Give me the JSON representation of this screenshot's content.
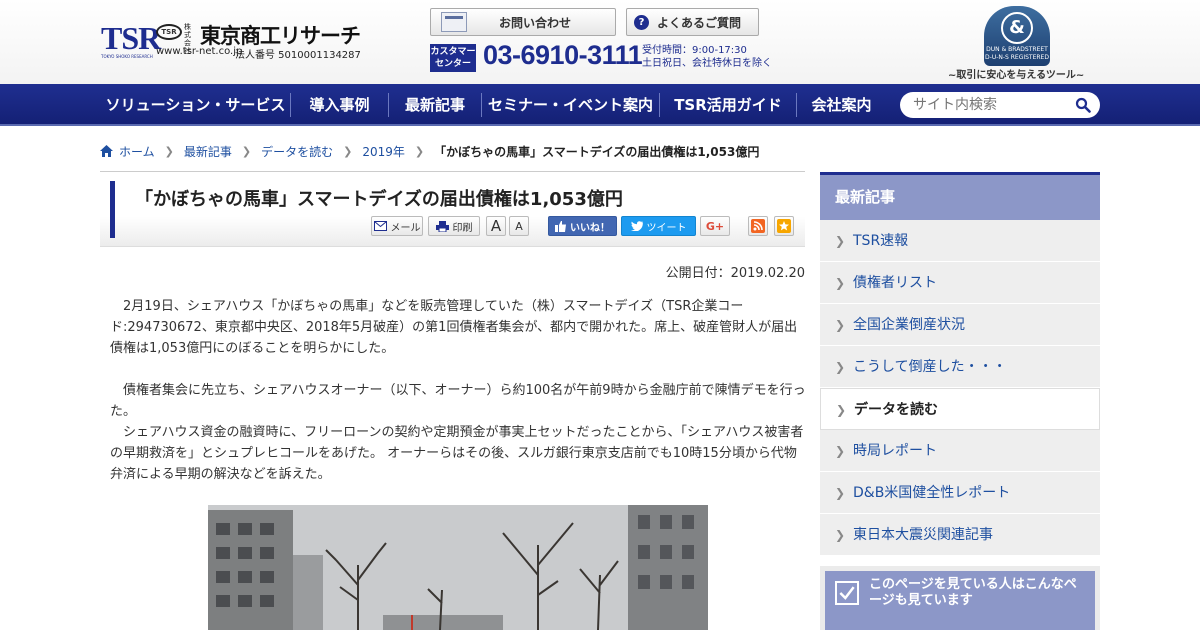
{
  "header": {
    "logo_tsr": "TSR",
    "logo_tsr_sub": "TOKYO SHOKO RESEARCH",
    "logo_mark": "TSR",
    "logo_kaisha": "株式会社",
    "logo_name": "東京商工リサーチ",
    "logo_url": "www.tsr-net.co.jp",
    "corporate_number": "法人番号 5010001134287",
    "contact_label": "お問い合わせ",
    "faq_label": "よくあるご質問",
    "customer_center": "カスタマーセンター",
    "phone": "03-6910-3111",
    "hours_line1": "受付時間：9:00-17:30",
    "hours_line2": "土日祝日、会社特休日を除く",
    "dnb_symbol": "&",
    "dnb_text": "DUN & BRADSTREET D-U-N-S REGISTERED",
    "dnb_tagline": "~取引に安心を与えるツール~"
  },
  "nav": {
    "items": [
      "ソリューション・サービス",
      "導入事例",
      "最新記事",
      "セミナー・イベント案内",
      "TSR活用ガイド",
      "会社案内"
    ],
    "search_placeholder": "サイト内検索"
  },
  "breadcrumb": {
    "items": [
      "ホーム",
      "最新記事",
      "データを読む",
      "2019年"
    ],
    "current": "「かぼちゃの馬車」スマートデイズの届出債権は1,053億円"
  },
  "article": {
    "title": "「かぼちゃの馬車」スマートデイズの届出債権は1,053億円",
    "tools": {
      "mail": "メール",
      "print": "印刷",
      "font_large": "A",
      "font_small": "A",
      "like": "いいね！",
      "tweet": "ツイート",
      "gplus": "G+"
    },
    "pubdate": "公開日付：2019.02.20",
    "paragraphs": [
      "　2月19日、シェアハウス「かぼちゃの馬車」などを販売管理していた（株）スマートデイズ（TSR企業コード:294730672、東京都中央区、2018年5月破産）の第1回債権者集会が、都内で開かれた。席上、破産管財人が届出債権は1,053億円にのぼることを明らかにした。",
      "　債権者集会に先立ち、シェアハウスオーナー（以下、オーナー）ら約100名が午前9時から金融庁前で陳情デモを行った。",
      "　シェアハウス資金の融資時に、フリーローンの契約や定期預金が事実上セットだったことから、「シェアハウス被害者の早期救済を」とシュプレヒコールをあげた。 オーナーらはその後、スルガ銀行東京支店前でも10時15分頃から代物弁済による早期の解決などを訴えた。"
    ]
  },
  "sidebar": {
    "heading": "最新記事",
    "items": [
      "TSR速報",
      "債権者リスト",
      "全国企業倒産状況",
      "こうして倒産した・・・",
      "データを読む",
      "時局レポート",
      "D&B米国健全性レポート",
      "東日本大震災関連記事"
    ],
    "active_item": "データを読む",
    "box_text": "このページを見ている人はこんなページも見ています"
  },
  "colors": {
    "brand_navy": "#1e2d8f",
    "sidebar_head": "#8c97c8",
    "link_blue": "#1e4fa0",
    "facebook": "#4267b2",
    "twitter": "#1d9bf0"
  }
}
